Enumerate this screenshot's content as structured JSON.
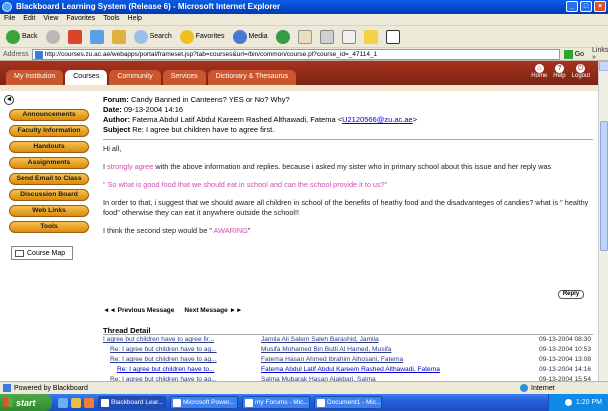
{
  "window": {
    "title": "Blackboard Learning System (Release 6) - Microsoft Internet Explorer",
    "controls": [
      "_",
      "□",
      "×"
    ]
  },
  "menu": [
    "File",
    "Edit",
    "View",
    "Favorites",
    "Tools",
    "Help"
  ],
  "toolbar": {
    "back": "Back",
    "search": "Search",
    "favorites": "Favorites",
    "media": "Media"
  },
  "address": {
    "label": "Address",
    "url": "http://courses.zu.ac.ae/webapps/portal/frameset.jsp?tab=courses&url=/bin/common/course.pl?course_id=_47114_1",
    "go": "Go",
    "links": "Links »"
  },
  "portal": {
    "tabs": [
      "My Institution",
      "Courses",
      "Community",
      "Services",
      "Dictionary & Thesaurus"
    ],
    "active_tab": 1,
    "icons": [
      "Home",
      "Help",
      "Logout"
    ]
  },
  "nav": {
    "buttons": [
      "Announcements",
      "Faculty Information",
      "Handouts",
      "Assignments",
      "Send Email to Class",
      "Discussion Board",
      "Web Links",
      "Tools"
    ],
    "course_map": "Course Map"
  },
  "message": {
    "forum_label": "Forum:",
    "forum": "Candy Banned in Canteens? YES or No? Why?",
    "date_label": "Date:",
    "date": "09-13-2004 14:16",
    "author_label": "Author:",
    "author": "Fatema Abdul Latif Abdul Kareem Rashed Althawadi, Fatema <",
    "author_email": "U2120566@zu.ac.ae",
    "author_end": ">",
    "subject_label": "Subject",
    "subject": "Re: I agree but children have to agree first.",
    "greeting": "Hi all,",
    "p1_a": "I ",
    "p1_pink": "strongly agree",
    "p1_b": " with the above information and replies. because i asked my sister who in primary school about this issue and her reply was",
    "quote": "\" So what is  good food that we should eat in school and can the school provide it to us?\"",
    "p2": "In order to that, i suggest that we should aware all children in school of the benefits of heathy food and the disadvanteges of candies? what is \" healthy food\" otherwise they can eat it anywhere outside the school!!",
    "p3_a": "I think the second step would be \" ",
    "p3_pink": "AWARING",
    "p3_b": "\"",
    "reply": "Reply",
    "prev": "◄◄ Previous Message",
    "next": "Next Message ►►"
  },
  "thread": {
    "title": "Thread Detail",
    "rows": [
      {
        "subject": "I agree but children have to agree fir...",
        "author": "Jamila Ali Salem Saleh Barashid, Jamila",
        "date": "09-13-2004 08:30",
        "indent": 0
      },
      {
        "subject": "Re: I agree but children have to ag...",
        "author": "Musifa Mohamed Bin Butti Al Hamed, Musifa",
        "date": "09-13-2004 10:53",
        "indent": 1
      },
      {
        "subject": "Re: I agree but children have to ag...",
        "author": "Fatema Hasan Ahmed Ibrahim Alhosani, Fatema",
        "date": "09-13-2004 13:08",
        "indent": 1
      },
      {
        "subject": "Re: I agree but children have to...",
        "author": "Fatema Abdul Latif Abdul Kareem Rashed Althawadi, Fatema",
        "date": "09-13-2004 14:16",
        "indent": 2,
        "current": true
      },
      {
        "subject": "Re: I agree but children have to ag...",
        "author": "Salma Mubarak Hasan Alakbari, Salma",
        "date": "09-13-2004 15:54",
        "indent": 1
      },
      {
        "subject": "Re: I agree but children have to ag...",
        "author": "Sumaia Abdulla Saleh Mubarak, Sumaia",
        "date": "09-15-2004 07:36",
        "indent": 1
      }
    ],
    "ok": "OK"
  },
  "status": {
    "text": "Powered by Blackboard",
    "zone": "Internet"
  },
  "taskbar": {
    "start": "start",
    "tasks": [
      "Blackboard Lear...",
      "Microsoft Power...",
      "my Forums - Mic...",
      "Document1 - Mic..."
    ],
    "active_task": 0,
    "clock": "1:20 PM"
  }
}
